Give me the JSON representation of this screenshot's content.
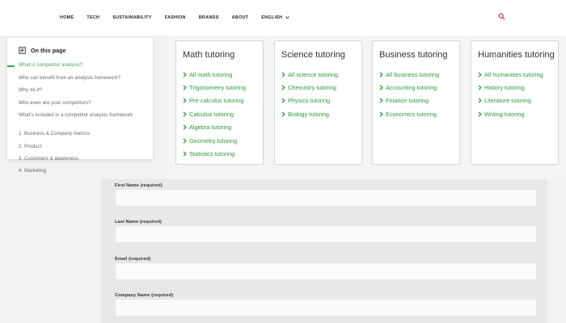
{
  "nav": {
    "items": [
      "HOME",
      "TECH",
      "SUSTAINABILITY",
      "FASHION",
      "BRANDS",
      "ABOUT"
    ],
    "language": "ENGLISH",
    "accent": "#d63aa8"
  },
  "toc": {
    "title": "On this page",
    "items": [
      "What is competitor analysis?",
      "Who can benefit from an analysis framework?",
      "Why do it?",
      "Who even are your competitors?",
      "What's included in a competitor analysis framework",
      "1. Business & Company metrics",
      "2. Product",
      "3. Customers & awareness",
      "4. Marketing"
    ],
    "active_index": 0,
    "accent": "#3aa34a"
  },
  "cards": [
    {
      "title": "Math tutoring",
      "links": [
        "All math tutoring",
        "Trigonometry tutoring",
        "Pre-calculus tutoring",
        "Calculus tutoring",
        "Algebra tutoring",
        "Geometry tutoring",
        "Statistics tutoring"
      ]
    },
    {
      "title": "Science tutoring",
      "links": [
        "All science tutoring",
        "Chemistry tutoring",
        "Physics tutoring",
        "Biology tutoring"
      ]
    },
    {
      "title": "Business tutoring",
      "links": [
        "All business tutoring",
        "Accounting tutoring",
        "Finance tutoring",
        "Economics tutoring"
      ]
    },
    {
      "title": "Humanities tutoring",
      "links": [
        "All humanities tutoring",
        "History tutoring",
        "Literature tutoring",
        "Writing tutoring"
      ]
    }
  ],
  "link_color": "#2c9a3a",
  "form": {
    "fields": [
      {
        "label": "First Name (required)",
        "value": ""
      },
      {
        "label": "Last Name (required)",
        "value": ""
      },
      {
        "label": "Email (required)",
        "value": ""
      },
      {
        "label": "Company Name (required)",
        "value": ""
      }
    ]
  }
}
